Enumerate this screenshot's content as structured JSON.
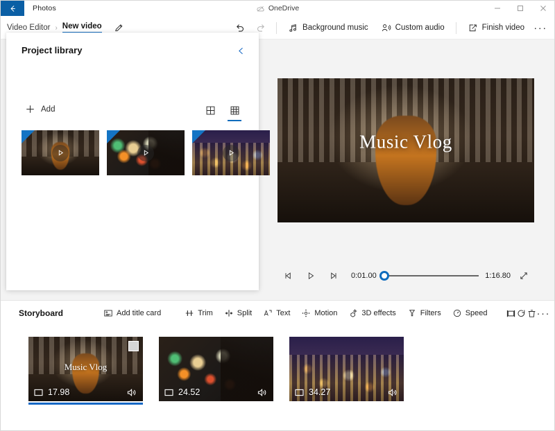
{
  "titlebar": {
    "app_name": "Photos",
    "back_icon": "back-arrow-icon",
    "cloud_label": "OneDrive",
    "cloud_icon": "onedrive-icon",
    "minimize_icon": "minimize-icon",
    "maximize_icon": "maximize-icon",
    "close_icon": "close-icon",
    "accent_color": "#0b5fa5"
  },
  "commandbar": {
    "breadcrumb_root": "Video Editor",
    "breadcrumb_separator": "›",
    "breadcrumb_current": "New video",
    "rename_icon": "pencil-icon",
    "undo_icon": "undo-icon",
    "redo_icon": "redo-icon",
    "actions": [
      {
        "label": "Background music",
        "icon": "music-note-icon"
      },
      {
        "label": "Custom audio",
        "icon": "person-audio-icon"
      },
      {
        "label": "Finish video",
        "icon": "export-icon"
      }
    ],
    "more_label": "···",
    "accent_color": "#0f6cbd"
  },
  "library": {
    "title": "Project library",
    "collapse_icon": "chevron-left-icon",
    "add_label": "Add",
    "add_icon": "plus-icon",
    "views": [
      {
        "name": "grid-large-view",
        "icon": "grid-large-icon",
        "active": false
      },
      {
        "name": "grid-small-view",
        "icon": "grid-small-icon",
        "active": true
      }
    ],
    "items": [
      {
        "name": "concert-hall-cellist",
        "art": "art-hall",
        "play_icon": "play-icon"
      },
      {
        "name": "violinist-night-bokeh",
        "art": "art-bokeh",
        "play_icon": "play-icon"
      },
      {
        "name": "city-skyline-night",
        "art": "art-city",
        "play_icon": "play-icon"
      }
    ]
  },
  "preview": {
    "overlay_title": "Music Vlog",
    "prev_frame_icon": "previous-frame-icon",
    "play_icon": "play-icon",
    "next_frame_icon": "next-frame-icon",
    "current_time": "0:01.00",
    "total_time": "1:16.80",
    "progress_percent": 1.3,
    "fullscreen_icon": "fullscreen-icon",
    "thumb_color": "#0f6cbd"
  },
  "storyboard": {
    "title": "Storyboard",
    "tools": [
      {
        "label": "Add title card",
        "icon": "title-card-icon"
      },
      {
        "label": "Trim",
        "icon": "trim-icon"
      },
      {
        "label": "Split",
        "icon": "split-icon"
      },
      {
        "label": "Text",
        "icon": "text-icon"
      },
      {
        "label": "Motion",
        "icon": "motion-icon"
      },
      {
        "label": "3D effects",
        "icon": "3d-effects-icon"
      },
      {
        "label": "Filters",
        "icon": "filters-icon"
      },
      {
        "label": "Speed",
        "icon": "speed-icon"
      }
    ],
    "icon_tools": [
      {
        "name": "resize-button",
        "icon": "resize-icon"
      },
      {
        "name": "rotate-button",
        "icon": "rotate-icon"
      },
      {
        "name": "delete-button",
        "icon": "trash-icon"
      },
      {
        "name": "more-button",
        "icon": "ellipsis-icon"
      }
    ],
    "more_label": "···",
    "clips": [
      {
        "name": "clip-concert-hall",
        "art": "art-hall",
        "overlay_title": "Music Vlog",
        "duration": "17.98",
        "selected": true,
        "has_checkbox": true,
        "duration_icon": "video-frame-icon",
        "audio_icon": "speaker-icon"
      },
      {
        "name": "clip-violinist",
        "art": "art-bokeh",
        "overlay_title": "",
        "duration": "24.52",
        "selected": false,
        "has_checkbox": false,
        "duration_icon": "video-frame-icon",
        "audio_icon": "speaker-icon"
      },
      {
        "name": "clip-city-skyline",
        "art": "art-city",
        "overlay_title": "",
        "duration": "34.27",
        "selected": false,
        "has_checkbox": false,
        "duration_icon": "video-frame-icon",
        "audio_icon": "speaker-icon"
      }
    ],
    "selection_color": "#1668c4"
  }
}
